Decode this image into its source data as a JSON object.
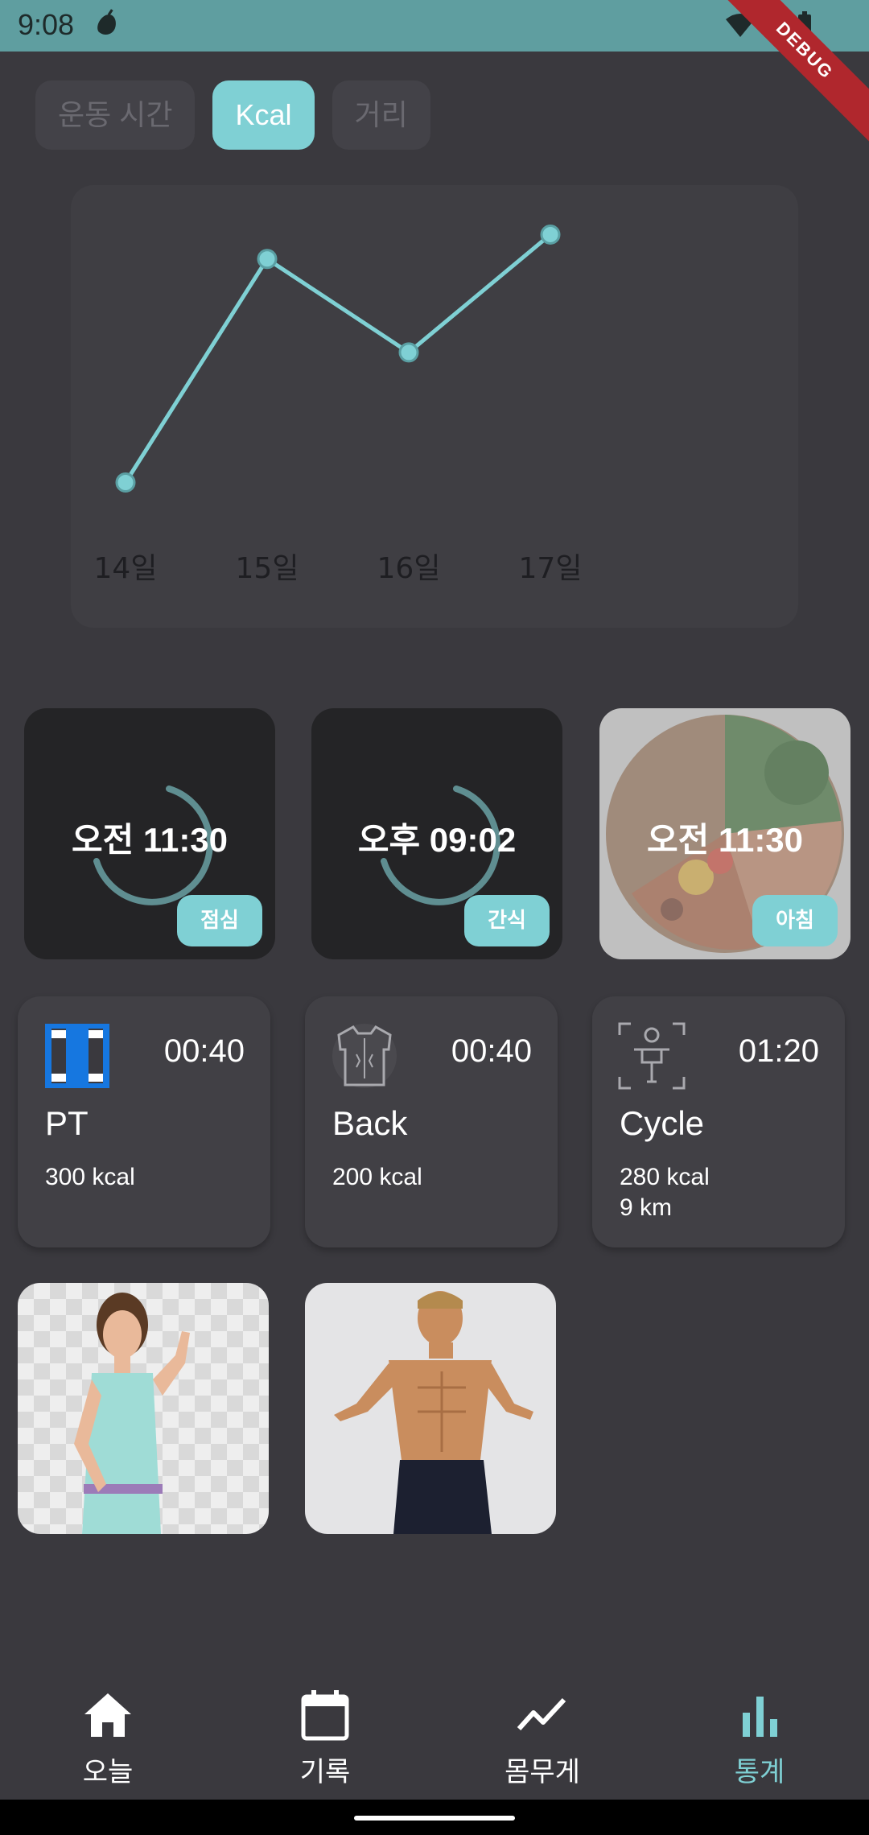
{
  "status_bar": {
    "time": "9:08",
    "debug_label": "DEBUG"
  },
  "tabs": [
    {
      "label": "운동 시간",
      "active": false
    },
    {
      "label": "Kcal",
      "active": true
    },
    {
      "label": "거리",
      "active": false
    }
  ],
  "chart_data": {
    "type": "line",
    "categories": [
      "14일",
      "15일",
      "16일",
      "17일"
    ],
    "values": [
      1,
      6.5,
      4.2,
      7.1
    ],
    "ylim": [
      0,
      8
    ],
    "color": "#7fd0d4",
    "grid": false
  },
  "meals": [
    {
      "time": "오전 11:30",
      "tag": "점심",
      "has_photo": false
    },
    {
      "time": "오후 09:02",
      "tag": "간식",
      "has_photo": false
    },
    {
      "time": "오전 11:30",
      "tag": "아침",
      "has_photo": true
    }
  ],
  "workouts": [
    {
      "icon": "dumbbell-icon",
      "duration": "00:40",
      "name": "PT",
      "stats": [
        "300 kcal"
      ]
    },
    {
      "icon": "back-muscle-icon",
      "duration": "00:40",
      "name": "Back",
      "stats": [
        "200 kcal"
      ]
    },
    {
      "icon": "cycle-machine-icon",
      "duration": "01:20",
      "name": "Cycle",
      "stats": [
        "280 kcal",
        "9 km"
      ]
    }
  ],
  "nav": [
    {
      "label": "오늘",
      "icon": "home-icon",
      "active": false
    },
    {
      "label": "기록",
      "icon": "calendar-icon",
      "active": false
    },
    {
      "label": "몸무게",
      "icon": "trend-line-icon",
      "active": false
    },
    {
      "label": "통계",
      "icon": "bar-chart-icon",
      "active": true
    }
  ],
  "colors": {
    "accent": "#7fd0d4",
    "background": "#3a393e",
    "status_bar": "#5f9ea0"
  }
}
